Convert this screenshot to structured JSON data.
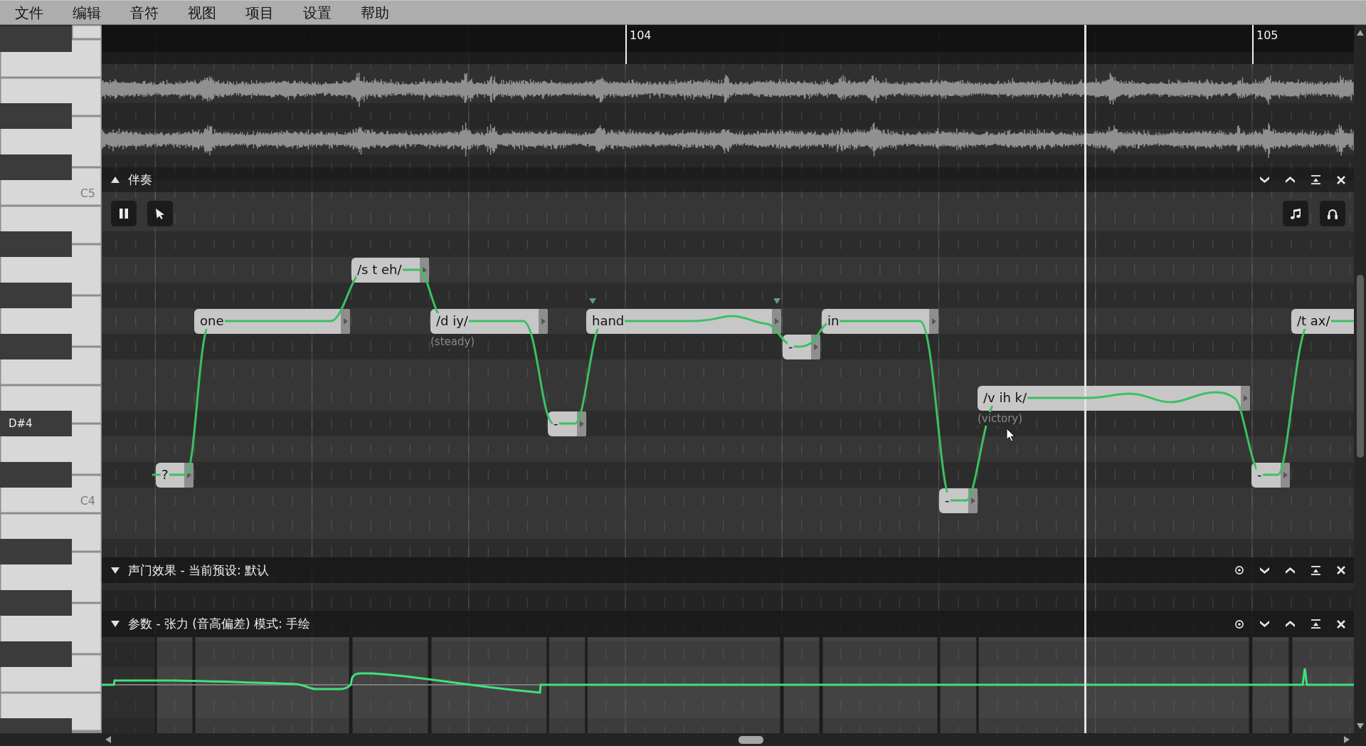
{
  "menu_bar": {
    "items": [
      "文件",
      "编辑",
      "音符",
      "视图",
      "项目",
      "设置",
      "帮助"
    ]
  },
  "piano_keyboard": {
    "labels": [
      {
        "text": "C5",
        "highlighted": false
      },
      {
        "text": "D#4",
        "highlighted": true
      },
      {
        "text": "C4",
        "highlighted": false
      }
    ]
  },
  "ruler": {
    "bars": [
      "104",
      "105"
    ]
  },
  "accompaniment_track": {
    "title": "伴奏",
    "expanded": true
  },
  "notes": [
    {
      "lyric": "?",
      "marked": false
    },
    {
      "lyric": "one",
      "marked": false
    },
    {
      "lyric": "/s t eh/",
      "marked": false
    },
    {
      "lyric": "/d iy/",
      "word": "(steady)",
      "marked": false
    },
    {
      "lyric": "-",
      "marked": false
    },
    {
      "lyric": "hand",
      "marked": true
    },
    {
      "lyric": "-",
      "marked": false
    },
    {
      "lyric": "in",
      "marked": false
    },
    {
      "lyric": "-",
      "marked": false
    },
    {
      "lyric": "/v ih k/",
      "word": "(victory)",
      "marked": false
    },
    {
      "lyric": "-",
      "marked": false
    },
    {
      "lyric": "/t ax/",
      "marked": false
    }
  ],
  "panels": [
    {
      "title": "声门效果 - 当前预设: 默认",
      "expanded": true
    },
    {
      "title": "参数 - 张力 (音高偏差) 模式: 手绘",
      "expanded": true
    }
  ]
}
